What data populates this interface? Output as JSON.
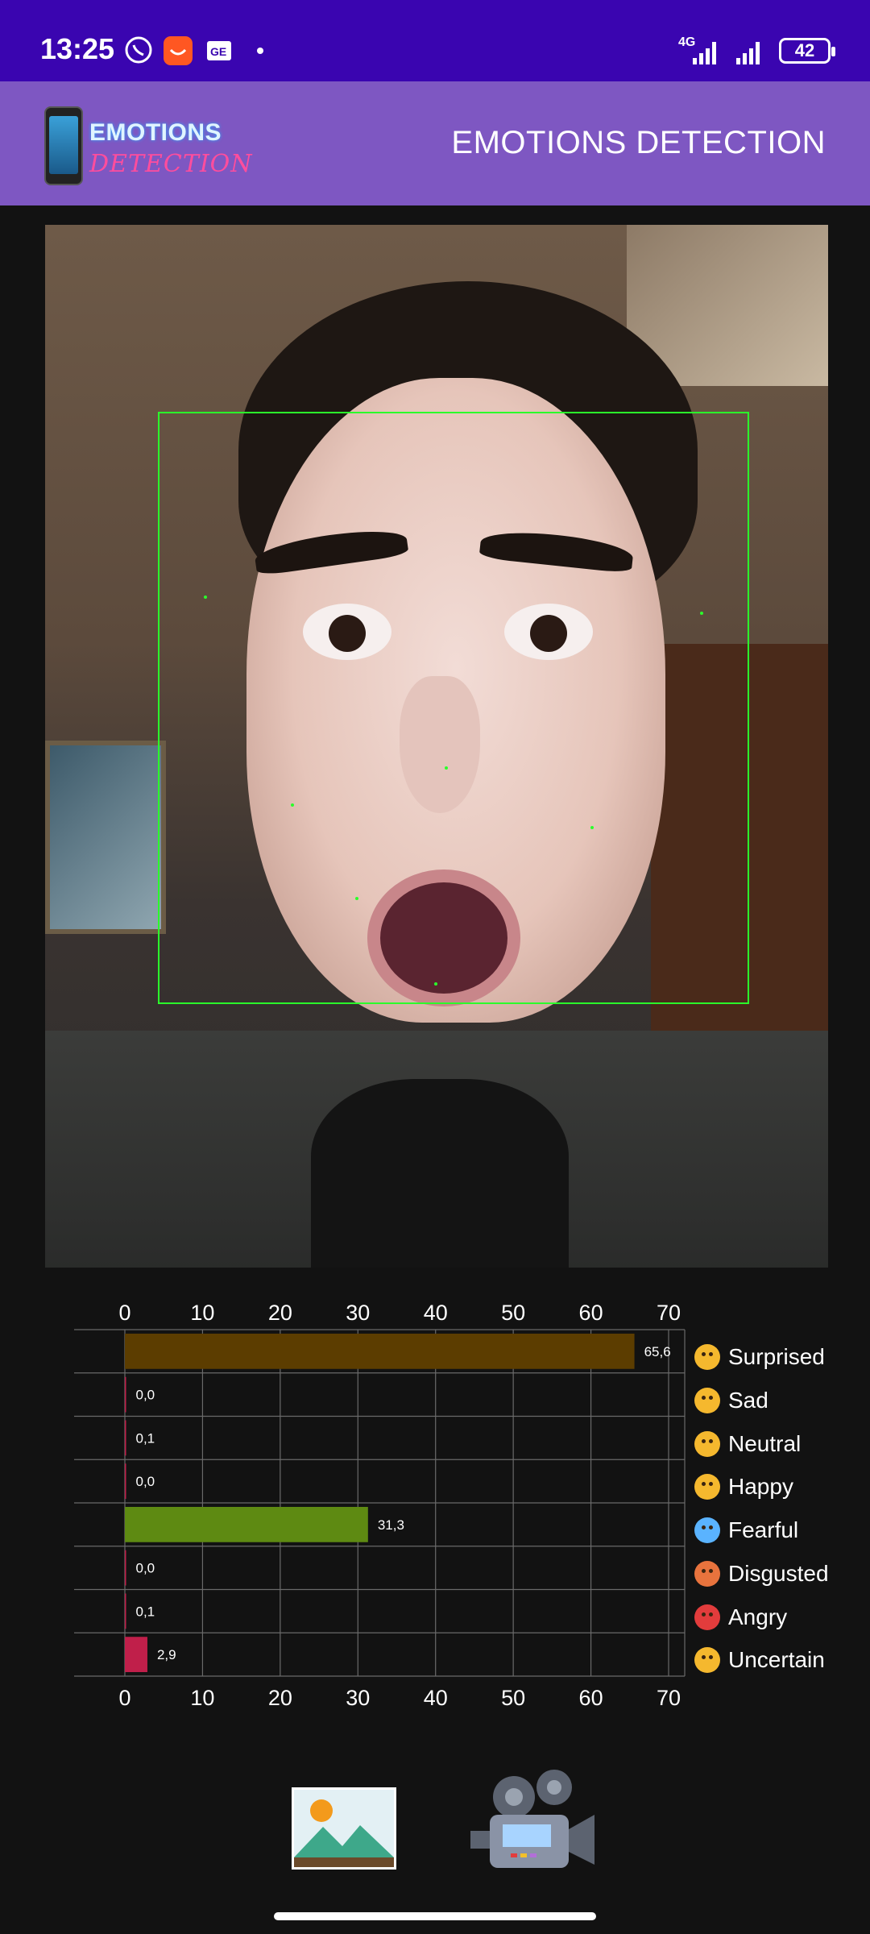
{
  "status_bar": {
    "time": "13:25",
    "network": "4G",
    "battery": "42",
    "icons": [
      "whatsapp-icon",
      "shopping-app-icon",
      "news-icon",
      "dot-icon",
      "signal-icon",
      "signal-icon",
      "battery-icon"
    ]
  },
  "app_bar": {
    "title": "EMOTIONS DETECTION",
    "logo_text_line1": "EMOTIONS",
    "logo_text_line2": "DETECTION"
  },
  "preview": {
    "face_box_color": "#2bff2b"
  },
  "chart_data": {
    "type": "bar",
    "orientation": "horizontal",
    "categories": [
      "Surprised",
      "Sad",
      "Neutral",
      "Happy",
      "Fearful",
      "Disgusted",
      "Angry",
      "Uncertain"
    ],
    "values": [
      65.6,
      0.0,
      0.1,
      0.0,
      31.3,
      0.0,
      0.1,
      2.9
    ],
    "value_labels": [
      "65,6",
      "0,0",
      "0,1",
      "0,0",
      "31,3",
      "0,0",
      "0,1",
      "2,9"
    ],
    "colors": [
      "#5c3d00",
      "#c01f4a",
      "#c01f4a",
      "#c01f4a",
      "#5e8a12",
      "#c01f4a",
      "#c01f4a",
      "#c01f4a"
    ],
    "xlim": [
      0,
      72
    ],
    "x_ticks": [
      "0",
      "10",
      "20",
      "30",
      "40",
      "50",
      "60",
      "70"
    ],
    "grid": true,
    "legend_placement": "right",
    "legend_icons": [
      "surprised-emoji-icon",
      "sad-emoji-icon",
      "neutral-emoji-icon",
      "happy-emoji-icon",
      "fearful-emoji-icon",
      "disgusted-emoji-icon",
      "angry-emoji-icon",
      "uncertain-emoji-icon"
    ]
  },
  "buttons": {
    "gallery_icon": "image-gallery-icon",
    "camera_icon": "video-camera-icon"
  },
  "colors": {
    "status_bar": "#3a05b0",
    "app_bar": "#7e57c2",
    "background": "#121212"
  }
}
